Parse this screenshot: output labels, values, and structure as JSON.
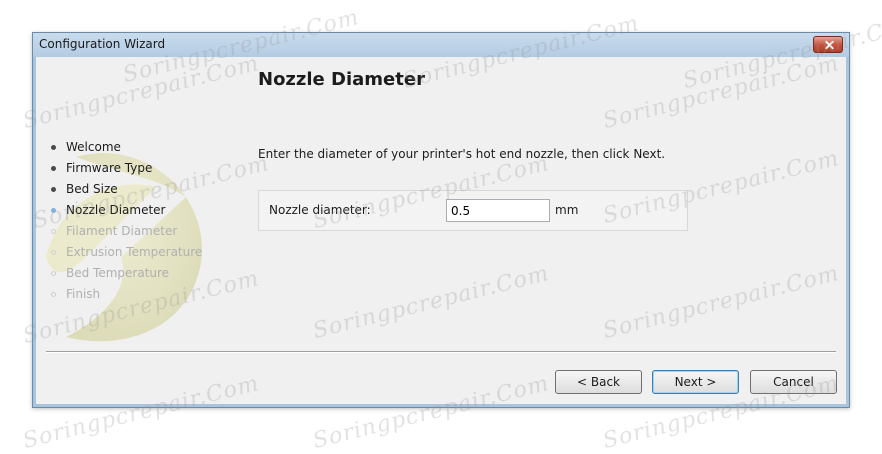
{
  "window": {
    "title": "Configuration Wizard"
  },
  "page": {
    "heading": "Nozzle Diameter",
    "instruction": "Enter the diameter of your printer's hot end nozzle, then click Next.",
    "field_label": "Nozzle diameter:",
    "field_value": "0.5",
    "unit": "mm"
  },
  "steps": [
    {
      "label": "Welcome",
      "state": "done"
    },
    {
      "label": "Firmware Type",
      "state": "done"
    },
    {
      "label": "Bed Size",
      "state": "done"
    },
    {
      "label": "Nozzle Diameter",
      "state": "current"
    },
    {
      "label": "Filament Diameter",
      "state": "pending"
    },
    {
      "label": "Extrusion Temperature",
      "state": "pending"
    },
    {
      "label": "Bed Temperature",
      "state": "pending"
    },
    {
      "label": "Finish",
      "state": "pending"
    }
  ],
  "buttons": {
    "back": "< Back",
    "next": "Next >",
    "cancel": "Cancel"
  },
  "watermark": "Soringpcrepair.Com",
  "colors": {
    "title_bar": "#b3cbe2",
    "close_button": "#c8533f",
    "current_step_dot": "#7fb2e0",
    "client_bg": "#f0f0f0"
  }
}
